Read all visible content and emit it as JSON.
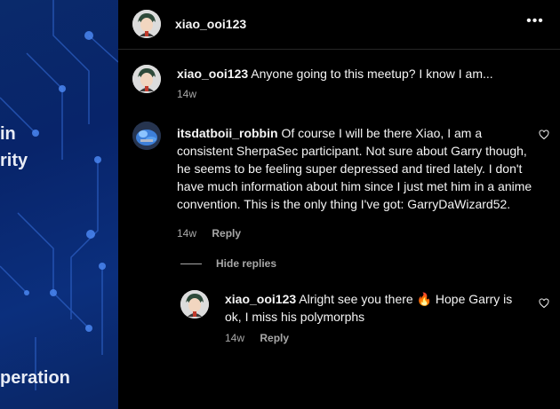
{
  "left_panel": {
    "line1": "in",
    "line2": "rity",
    "line3": "peration"
  },
  "header": {
    "username": "xiao_ooi123"
  },
  "comments": [
    {
      "username": "xiao_ooi123",
      "text": "Anyone going to this meetup? I know I am...",
      "time": "14w"
    },
    {
      "username": "itsdatboii_robbin",
      "text": "Of course I will be there Xiao, I am a consistent SherpaSec participant. Not sure about Garry though, he seems to be feeling super depressed and tired lately. I don't have much information about him since I just met him in a anime convention. This is the only thing I've got: GarryDaWizard52.",
      "time": "14w",
      "reply": "Reply"
    }
  ],
  "hide_replies": "Hide replies",
  "replies": [
    {
      "username": "xiao_ooi123",
      "text_before": "Alright see you there",
      "emoji": "🔥",
      "text_after": "Hope Garry is ok, I miss his polymorphs",
      "time": "14w",
      "reply": "Reply"
    }
  ],
  "colors": {
    "background": "#000000",
    "text": "#f5f5f5",
    "muted": "#a8a8a8",
    "left_panel": "#0a2a6b"
  }
}
